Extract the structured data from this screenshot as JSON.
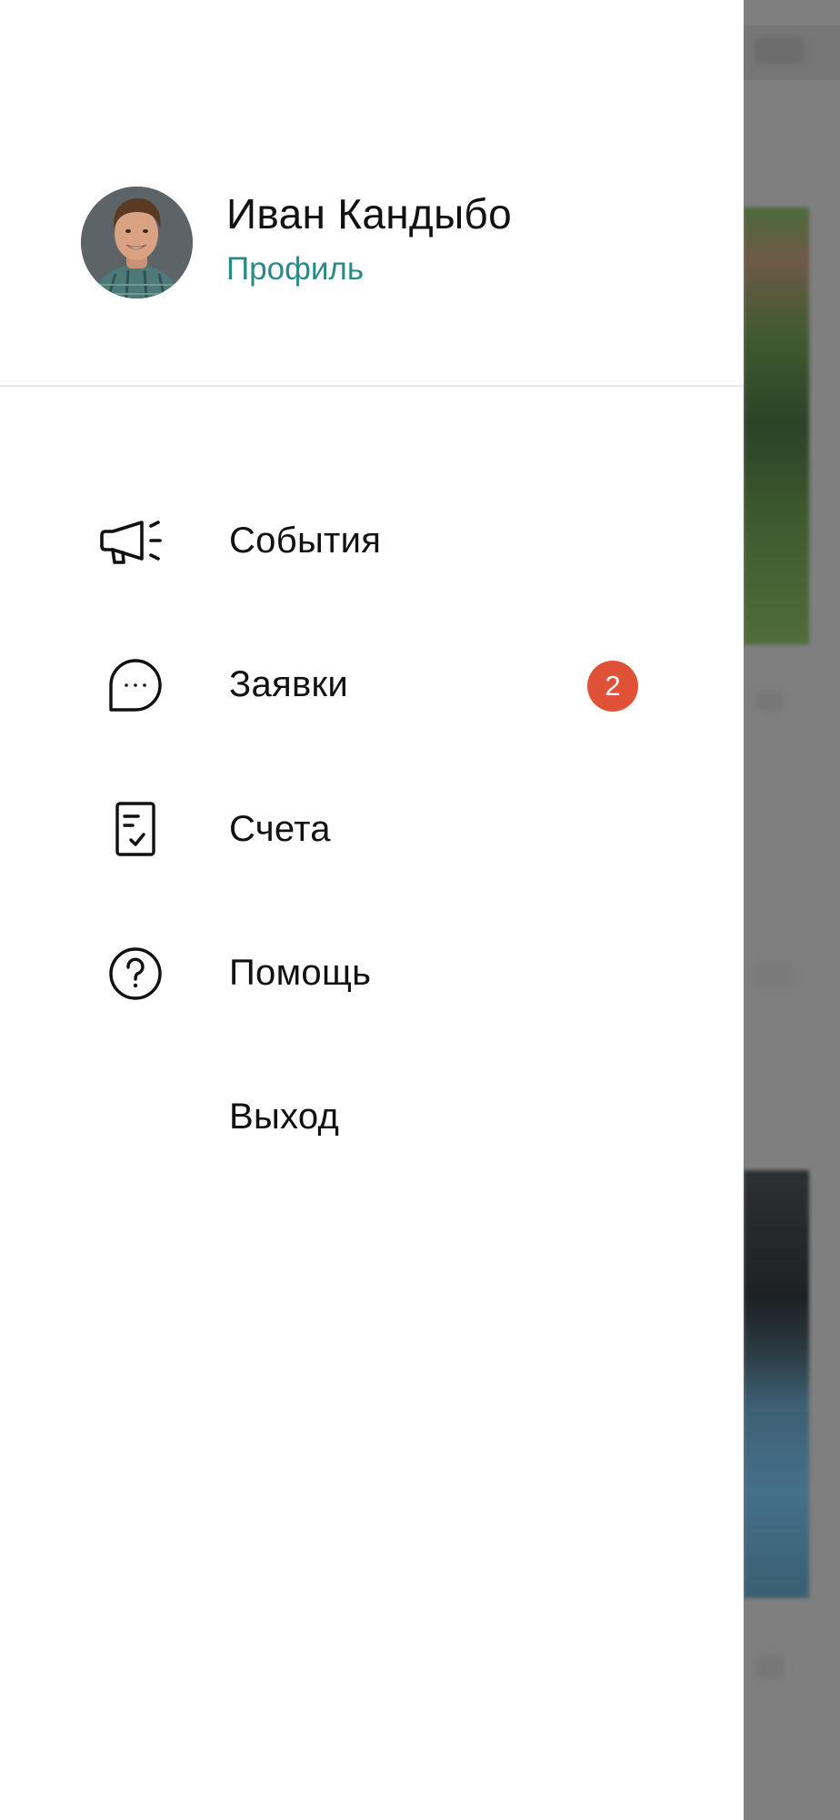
{
  "profile": {
    "name": "Иван Кандыбо",
    "link_label": "Профиль"
  },
  "menu": {
    "items": [
      {
        "label": "События",
        "icon": "megaphone-icon"
      },
      {
        "label": "Заявки",
        "icon": "chat-bubble-icon",
        "badge": "2"
      },
      {
        "label": "Счета",
        "icon": "invoice-icon"
      },
      {
        "label": "Помощь",
        "icon": "help-icon"
      },
      {
        "label": "Выход",
        "icon": ""
      }
    ]
  },
  "colors": {
    "accent": "#2a8a86",
    "badge": "#e05238",
    "text": "#111111",
    "backdrop": "#7f7f7f"
  }
}
